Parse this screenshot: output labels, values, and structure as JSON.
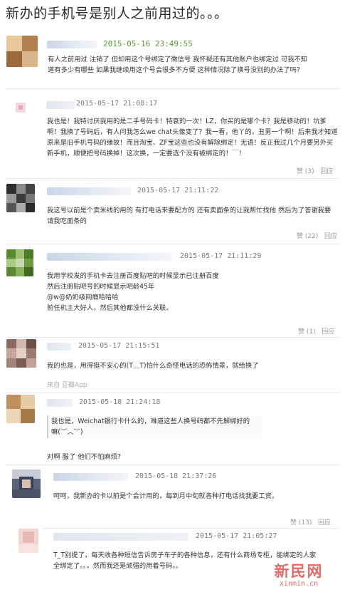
{
  "title": "新办的手机号是别人之前用过的。。。",
  "op": {
    "time": "2015-05-16 23:49:55",
    "lines": [
      "有人之前用过 注销了 但却用这个号绑定了微信号 我怀疑还有其他账户也绑定过 可我不知",
      "道有多少有哪些 如果我继续用这个号会很多不方便 这种情况除了换号没别的办法了吗?"
    ]
  },
  "replies": [
    {
      "time": "2015-05-17 21:08:17",
      "lines": [
        "我也是！我特讨厌我用的是二手号码卡！特衰的一次！LZ，你买的是哪个卡？我是移动的！坑爹",
        "啊！我换了号码后，有人问我怎么we chat头像变了？我一看，他丫的，丑男一个啊！后来我才知道",
        "原来是旧手机号码的缘故！而且淘宝、ZF宝这些也没有解除绑定！无语！反正我过几个月要另外买",
        "新手机，顺便把号码换掉！这次换，一定要选个没有被绑定的！￣！"
      ],
      "like": "赞 (3)",
      "reply": "回应"
    },
    {
      "time": "2015-05-17 21:11:22",
      "lines": [
        "我这号以前是个卖米线的用的 有打电话来要配方的 还有卖面条的让我帮忙找他 然后为了答谢我要",
        "请我吃面条的"
      ],
      "like": "赞 (22)",
      "reply": "回应"
    },
    {
      "time": "2015-05-17 21:11:29",
      "lines": [
        "我用学校发的手机卡去注册百度贴吧的时候显示已注册百度",
        "然后注册贴吧号的时候显示吧龄45年",
        "@w@奶奶级网瘾哈哈哈",
        "前任机主大好人，然后其他都没什么关联。"
      ],
      "like": "赞 (1)",
      "reply": "回应"
    },
    {
      "time": "2015-05-17 21:15:51",
      "lines": [
        "我的也是，用得挺不安心的(T＿T)怕什么奇怪电话的恐怖情景，就给换了"
      ],
      "source": "来自 豆瓣App"
    },
    {
      "time": "2015-05-18 21:24:18",
      "quote": [
        "我也是，Weichat银行卡什么的，难道这些人换号码都不先解绑好的",
        "嘛(︶︿︶)"
      ],
      "lines": [
        "对啊 服了 他们不怕麻烦?"
      ]
    },
    {
      "time": "2015-05-18 21:37:26",
      "lines": [
        "呵呵，我新办的卡以前是个会计用的，每到月中旬就各种打电话找我要工资。"
      ],
      "like": "赞 (13)",
      "reply": "回应"
    },
    {
      "time": "2015-05-17 21:05:27",
      "lines": [
        "T_T别提了，每天收各种短信告诉房子车子的各种信息，还有什么商场专柜，能绑定的人家",
        "全绑定了。。。然而我还是顽强的用着号码。。"
      ]
    }
  ],
  "watermark": {
    "main": "新民网",
    "sub": "xinmin.cn"
  },
  "colors": {
    "time_green": "#5a9a3a",
    "namebar": "#c9d6e6",
    "watermark": "#d9534f"
  }
}
